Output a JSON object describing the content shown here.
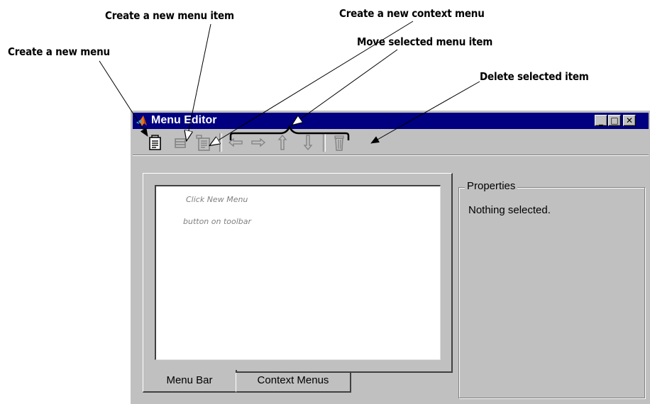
{
  "callouts": {
    "new_menu": "Create a new menu",
    "new_menu_item": "Create a new menu item",
    "new_context_menu": "Create a new context menu",
    "move_item": "Move selected menu item",
    "delete_item": "Delete selected item"
  },
  "window": {
    "title": "Menu Editor",
    "minimize": "_",
    "maximize": "□",
    "close": "✕"
  },
  "toolbar": {
    "icons": [
      "new-menu-icon",
      "new-menu-item-icon",
      "new-context-menu-icon",
      "move-left-icon",
      "move-right-icon",
      "move-up-icon",
      "move-down-icon",
      "delete-icon"
    ]
  },
  "list": {
    "hint_line1": "Click New Menu",
    "hint_line2": "button on toolbar"
  },
  "tabs": {
    "menu_bar": "Menu Bar",
    "context_menus": "Context Menus"
  },
  "properties": {
    "legend": "Properties",
    "status": "Nothing selected."
  },
  "colors": {
    "title_bar": "#000080",
    "window_bg": "#c0c0c0",
    "disabled_icon": "#808080"
  }
}
